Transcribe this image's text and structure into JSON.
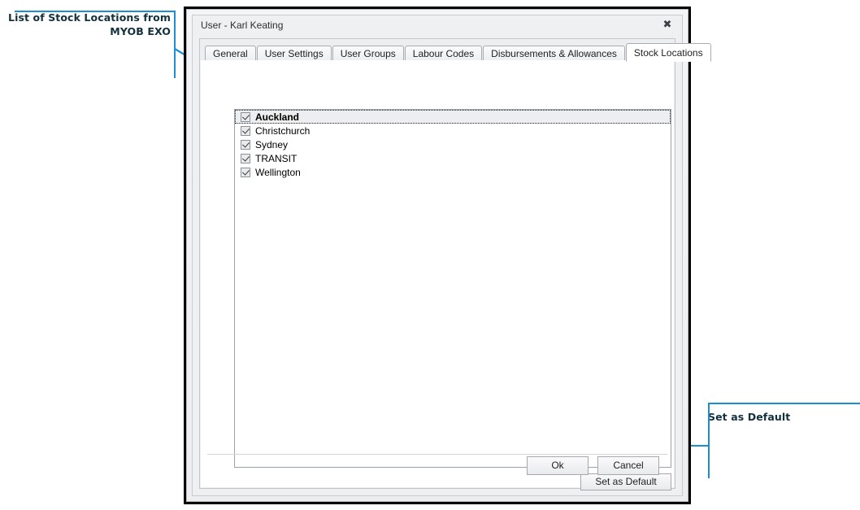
{
  "annotations": {
    "left": {
      "text": "List of Stock Locations from\nMYOB EXO",
      "color": "#13303d",
      "line_color": "#1b8ed6"
    },
    "right": {
      "text": "Set as Default",
      "color": "#13303d",
      "line_color": "#1b8ed6"
    }
  },
  "dialog": {
    "title": "User  - Karl Keating",
    "close_icon": "✖",
    "tabs": [
      {
        "label": "General",
        "active": false
      },
      {
        "label": "User Settings",
        "active": false
      },
      {
        "label": "User Groups",
        "active": false
      },
      {
        "label": "Labour Codes",
        "active": false
      },
      {
        "label": "Disbursements & Allowances",
        "active": false
      },
      {
        "label": "Stock Locations",
        "active": true
      }
    ],
    "stock_locations": [
      {
        "label": "Auckland",
        "checked": true,
        "focused": true
      },
      {
        "label": "Christchurch",
        "checked": true,
        "focused": false
      },
      {
        "label": "Sydney",
        "checked": true,
        "focused": false
      },
      {
        "label": "TRANSIT",
        "checked": true,
        "focused": false
      },
      {
        "label": "Wellington",
        "checked": true,
        "focused": false
      }
    ],
    "buttons": {
      "set_default": "Set as Default",
      "ok": "Ok",
      "cancel": "Cancel"
    }
  }
}
